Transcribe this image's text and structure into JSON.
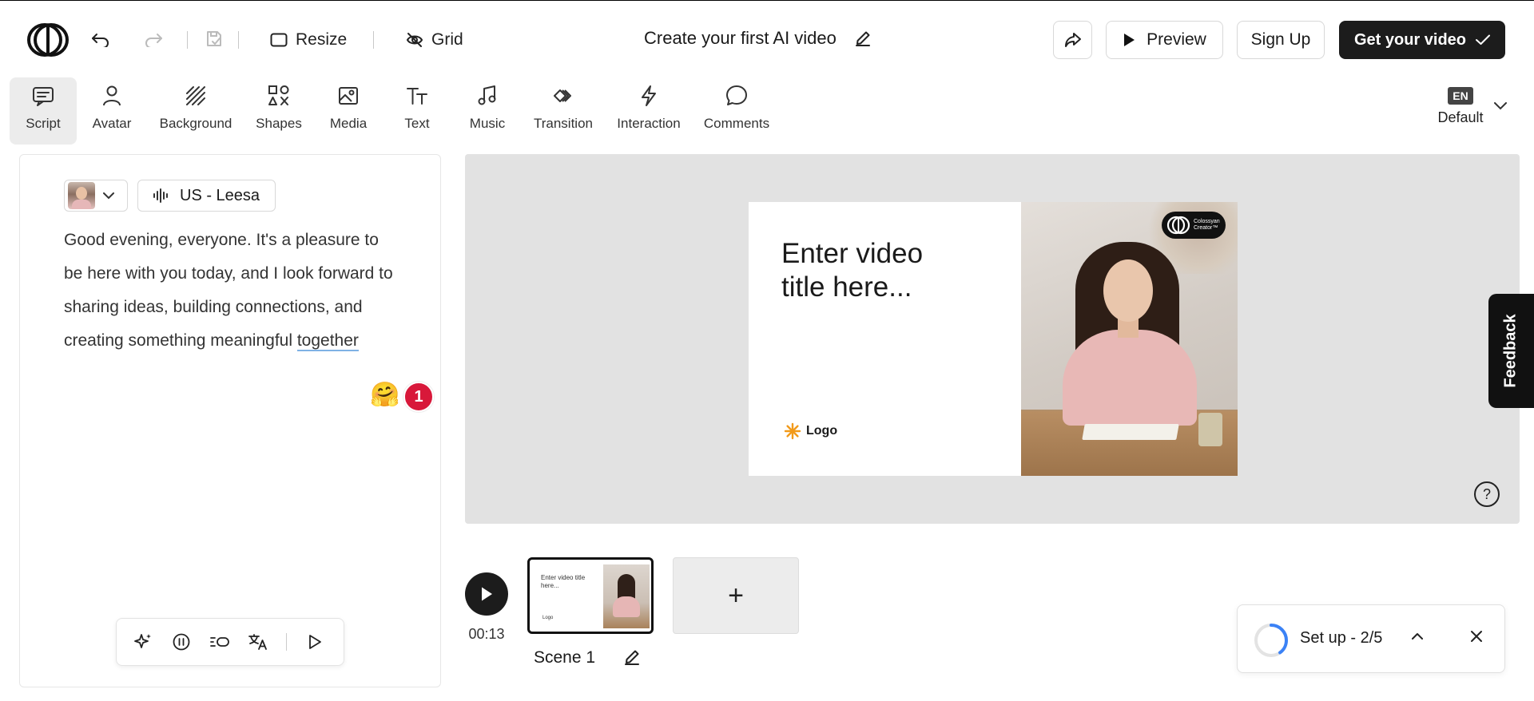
{
  "header": {
    "project_title": "Create your first AI video",
    "resize_label": "Resize",
    "grid_label": "Grid",
    "preview_label": "Preview",
    "signup_label": "Sign Up",
    "get_video_label": "Get your video"
  },
  "toolbar": {
    "items": [
      {
        "label": "Script",
        "icon": "script-icon"
      },
      {
        "label": "Avatar",
        "icon": "avatar-icon"
      },
      {
        "label": "Background",
        "icon": "background-icon"
      },
      {
        "label": "Shapes",
        "icon": "shapes-icon"
      },
      {
        "label": "Media",
        "icon": "media-icon"
      },
      {
        "label": "Text",
        "icon": "text-icon"
      },
      {
        "label": "Music",
        "icon": "music-icon"
      },
      {
        "label": "Transition",
        "icon": "transition-icon"
      },
      {
        "label": "Interaction",
        "icon": "interaction-icon"
      },
      {
        "label": "Comments",
        "icon": "comments-icon"
      }
    ],
    "active": "Script",
    "language": {
      "code": "EN",
      "label": "Default"
    }
  },
  "script_panel": {
    "voice_label": "US - Leesa",
    "text_main": "Good evening, everyone. It's a pleasure to be here with you today, and I look forward to sharing ideas, building connections, and creating something meaningful ",
    "text_underlined": "together",
    "comment_count": "1",
    "reaction_emoji": "🤗"
  },
  "canvas": {
    "slide_title": "Enter video title here...",
    "logo_text": "Logo",
    "brand_pill_text_1": "Colossyan",
    "brand_pill_text_2": "Creator™",
    "help": "?"
  },
  "feedback_label": "Feedback",
  "timeline": {
    "duration": "00:13",
    "scenes": [
      {
        "label": "Scene 1",
        "thumb_title": "Enter video title here...",
        "thumb_logo": "Logo"
      }
    ],
    "add_label": "+"
  },
  "setup": {
    "label": "Set up - 2/5",
    "progress": 0.4
  },
  "colors": {
    "accent_dark": "#1c1c1c",
    "badge_red": "#d8183a",
    "canvas_bg": "#e2e2e2",
    "spinner_blue": "#3b82f6"
  }
}
